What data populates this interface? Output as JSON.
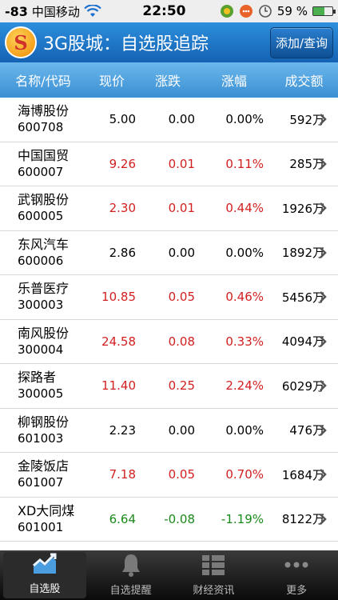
{
  "status_bar": {
    "signal": "-83",
    "carrier": "中国移动",
    "time": "22:50",
    "battery": "59 %",
    "battery_level": 0.59
  },
  "header": {
    "logo_letter": "S",
    "title": "3G股城：自选股追踪",
    "add_button": "添加/查询"
  },
  "columns": [
    "名称/代码",
    "现价",
    "涨跌",
    "涨幅",
    "成交额"
  ],
  "stocks": [
    {
      "name": "海博股份",
      "code": "600708",
      "price": "5.00",
      "change": "0.00",
      "pct": "0.00%",
      "volume": "592万",
      "trend": "flat"
    },
    {
      "name": "中国国贸",
      "code": "600007",
      "price": "9.26",
      "change": "0.01",
      "pct": "0.11%",
      "volume": "285万",
      "trend": "up"
    },
    {
      "name": "武钢股份",
      "code": "600005",
      "price": "2.30",
      "change": "0.01",
      "pct": "0.44%",
      "volume": "1926万",
      "trend": "up"
    },
    {
      "name": "东风汽车",
      "code": "600006",
      "price": "2.86",
      "change": "0.00",
      "pct": "0.00%",
      "volume": "1892万",
      "trend": "flat"
    },
    {
      "name": "乐普医疗",
      "code": "300003",
      "price": "10.85",
      "change": "0.05",
      "pct": "0.46%",
      "volume": "5456万",
      "trend": "up"
    },
    {
      "name": "南风股份",
      "code": "300004",
      "price": "24.58",
      "change": "0.08",
      "pct": "0.33%",
      "volume": "4094万",
      "trend": "up"
    },
    {
      "name": "探路者",
      "code": "300005",
      "price": "11.40",
      "change": "0.25",
      "pct": "2.24%",
      "volume": "6029万",
      "trend": "up"
    },
    {
      "name": "柳钢股份",
      "code": "601003",
      "price": "2.23",
      "change": "0.00",
      "pct": "0.00%",
      "volume": "476万",
      "trend": "flat"
    },
    {
      "name": "金陵饭店",
      "code": "601007",
      "price": "7.18",
      "change": "0.05",
      "pct": "0.70%",
      "volume": "1684万",
      "trend": "up"
    },
    {
      "name": "XD大同煤",
      "code": "601001",
      "price": "6.64",
      "change": "-0.08",
      "pct": "-1.19%",
      "volume": "8122万",
      "trend": "down"
    }
  ],
  "tabs": [
    {
      "label": "自选股",
      "icon": "chart-icon",
      "active": true
    },
    {
      "label": "自选提醒",
      "icon": "bell-icon",
      "active": false
    },
    {
      "label": "财经资讯",
      "icon": "news-list-icon",
      "active": false
    },
    {
      "label": "更多",
      "icon": "more-dots-icon",
      "active": false
    }
  ],
  "colors": {
    "up": "#d21f1f",
    "down": "#1a8a1a",
    "flat": "#000000",
    "brand": "#1a74c6"
  }
}
